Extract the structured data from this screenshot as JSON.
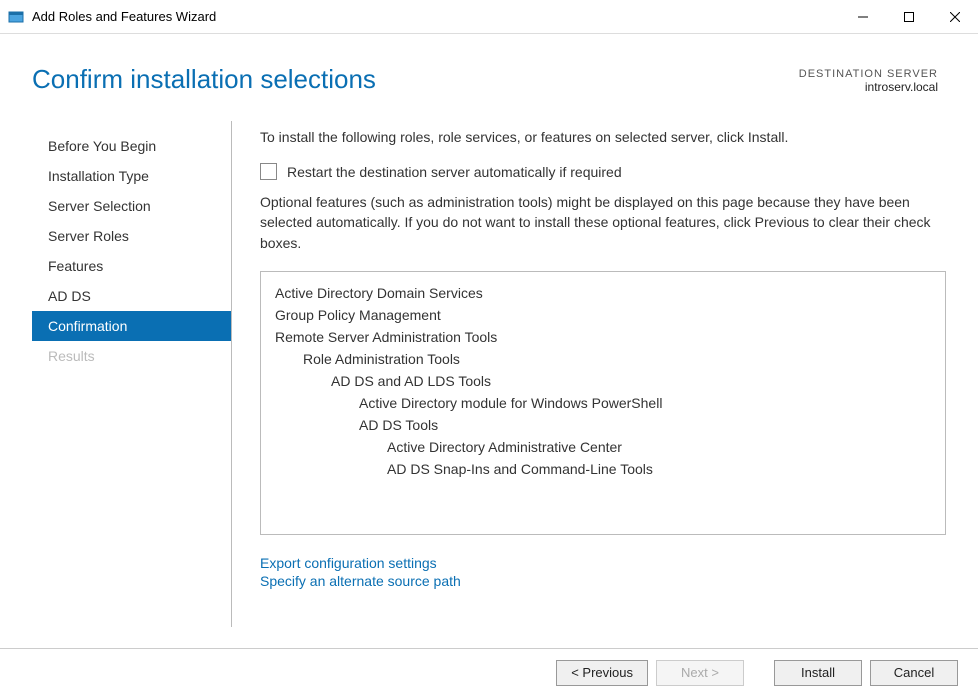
{
  "titlebar": {
    "title": "Add Roles and Features Wizard"
  },
  "header": {
    "page_title": "Confirm installation selections",
    "destination_label": "DESTINATION SERVER",
    "destination_value": "introserv.local"
  },
  "sidebar": {
    "items": [
      {
        "label": "Before You Begin",
        "active": false,
        "disabled": false
      },
      {
        "label": "Installation Type",
        "active": false,
        "disabled": false
      },
      {
        "label": "Server Selection",
        "active": false,
        "disabled": false
      },
      {
        "label": "Server Roles",
        "active": false,
        "disabled": false
      },
      {
        "label": "Features",
        "active": false,
        "disabled": false
      },
      {
        "label": "AD DS",
        "active": false,
        "disabled": false
      },
      {
        "label": "Confirmation",
        "active": true,
        "disabled": false
      },
      {
        "label": "Results",
        "active": false,
        "disabled": true
      }
    ]
  },
  "main": {
    "intro": "To install the following roles, role services, or features on selected server, click Install.",
    "checkbox_label": "Restart the destination server automatically if required",
    "checkbox_checked": false,
    "optional_text": "Optional features (such as administration tools) might be displayed on this page because they have been selected automatically. If you do not want to install these optional features, click Previous to clear their check boxes.",
    "selections": [
      {
        "label": "Active Directory Domain Services",
        "indent": 0
      },
      {
        "label": "Group Policy Management",
        "indent": 0
      },
      {
        "label": "Remote Server Administration Tools",
        "indent": 0
      },
      {
        "label": "Role Administration Tools",
        "indent": 1
      },
      {
        "label": "AD DS and AD LDS Tools",
        "indent": 2
      },
      {
        "label": "Active Directory module for Windows PowerShell",
        "indent": 3
      },
      {
        "label": "AD DS Tools",
        "indent": 3
      },
      {
        "label": "Active Directory Administrative Center",
        "indent": 4
      },
      {
        "label": "AD DS Snap-Ins and Command-Line Tools",
        "indent": 4
      }
    ],
    "links": {
      "export": "Export configuration settings",
      "alt_source": "Specify an alternate source path"
    }
  },
  "footer": {
    "previous": "< Previous",
    "next": "Next >",
    "install": "Install",
    "cancel": "Cancel",
    "next_disabled": true
  }
}
